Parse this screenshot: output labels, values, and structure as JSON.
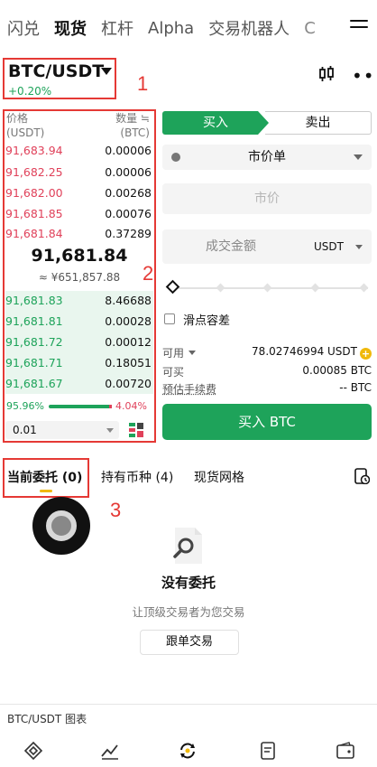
{
  "top_tabs": [
    "闪兑",
    "现货",
    "杠杆",
    "Alpha",
    "交易机器人",
    "C"
  ],
  "active_tab": 1,
  "pair": {
    "name": "BTC/USDT",
    "change": "+0.20%"
  },
  "annotations": [
    "1",
    "2",
    "3"
  ],
  "order_book": {
    "price_header": "价格\n(USDT)",
    "qty_header": "数量 ≒\n(BTC)",
    "asks": [
      {
        "price": "91,683.94",
        "qty": "0.00006"
      },
      {
        "price": "91,682.25",
        "qty": "0.00006"
      },
      {
        "price": "91,682.00",
        "qty": "0.00268"
      },
      {
        "price": "91,681.85",
        "qty": "0.00076"
      },
      {
        "price": "91,681.84",
        "qty": "0.37289"
      }
    ],
    "last_price": "91,681.84",
    "last_price_cny": "≈ ¥651,857.88",
    "bids": [
      {
        "price": "91,681.83",
        "qty": "8.46688"
      },
      {
        "price": "91,681.81",
        "qty": "0.00028"
      },
      {
        "price": "91,681.72",
        "qty": "0.00012"
      },
      {
        "price": "91,681.71",
        "qty": "0.18051"
      },
      {
        "price": "91,681.67",
        "qty": "0.00720"
      }
    ],
    "buy_ratio": "95.96%",
    "sell_ratio": "4.04%",
    "buy_ratio_value": 0.9596,
    "tick_size": "0.01"
  },
  "trade": {
    "buy_tab": "买入",
    "sell_tab": "卖出",
    "order_type": "市价单",
    "price_placeholder": "市价",
    "amount_label": "成交金额",
    "amount_unit": "USDT",
    "slippage_label": "滑点容差",
    "available_label": "可用",
    "available_value": "78.02746994 USDT",
    "can_buy_label": "可买",
    "can_buy_value": "0.00085 BTC",
    "fee_label": "预估手续费",
    "fee_value": "-- BTC",
    "buy_button": "买入 BTC"
  },
  "sub_tabs": {
    "current": "当前委托 (0)",
    "holdings": "持有币种 (4)",
    "grid": "现货网格"
  },
  "empty": {
    "title": "没有委托",
    "subtitle": "让顶级交易者为您交易",
    "button": "跟单交易"
  },
  "chart_link": "BTC/USDT 图表",
  "colors": {
    "green": "#1ea35a",
    "red": "#e0415a",
    "accent": "#f0b90b",
    "annotation": "#e53935"
  }
}
